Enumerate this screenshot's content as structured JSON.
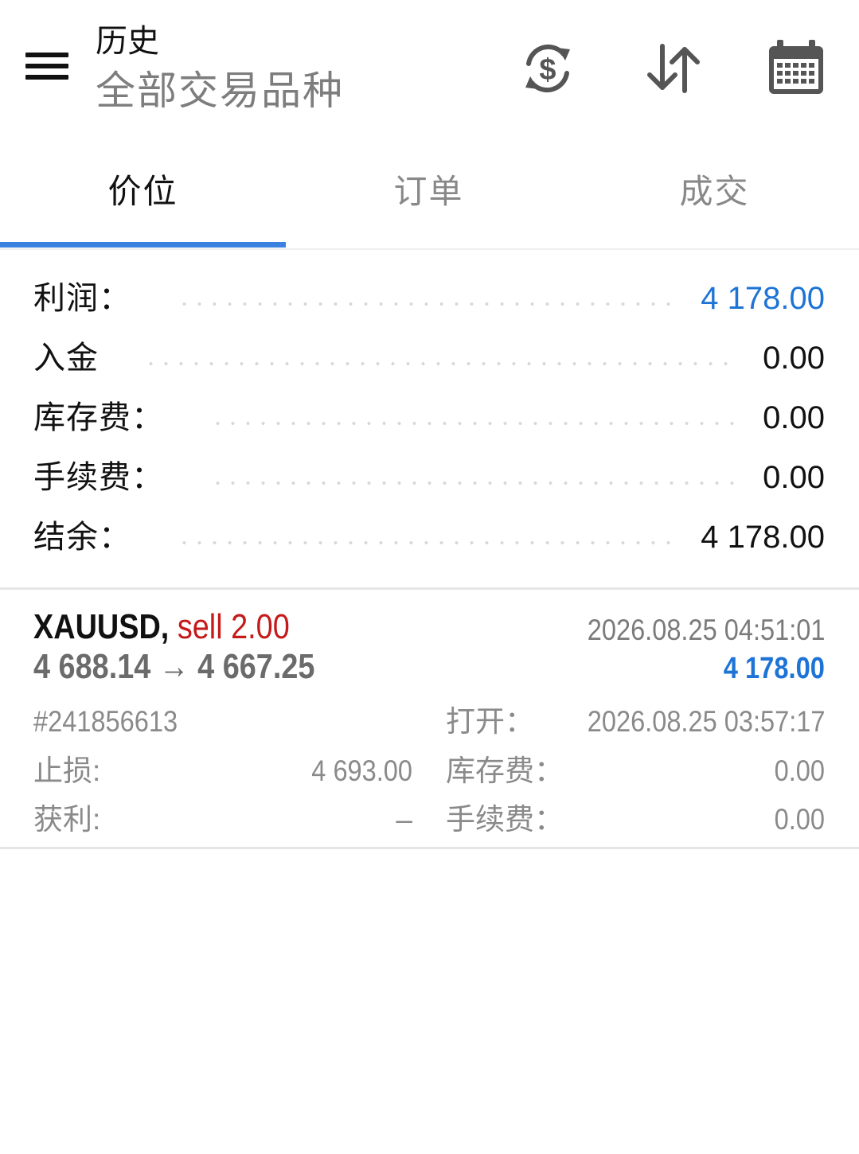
{
  "header": {
    "title": "历史",
    "subtitle": "全部交易品种",
    "icons": [
      "menu-icon",
      "currency-exchange-icon",
      "sort-icon",
      "calendar-icon"
    ]
  },
  "tabs": [
    {
      "label": "价位",
      "active": true
    },
    {
      "label": "订单",
      "active": false
    },
    {
      "label": "成交",
      "active": false
    }
  ],
  "summary": {
    "profit": {
      "label": "利润：",
      "value": "4 178.00"
    },
    "deposit": {
      "label": "入金",
      "value": "0.00"
    },
    "swap": {
      "label": "库存费：",
      "value": "0.00"
    },
    "commission": {
      "label": "手续费：",
      "value": "0.00"
    },
    "balance": {
      "label": "结余：",
      "value": "4 178.00"
    }
  },
  "deal": {
    "symbol": "XAUUSD,",
    "type_volume": "sell 2.00",
    "prices": "4 688.14 → 4 667.25",
    "close_time": "2026.08.25 04:51:01",
    "profit": "4 178.00",
    "ticket": "#241856613",
    "open_label": "打开：",
    "open_time": "2026.08.25 03:57:17",
    "sl_label": "止损:",
    "sl_value": "4 693.00",
    "swap_label": "库存费：",
    "swap_value": "0.00",
    "tp_label": "获利:",
    "tp_value": "–",
    "commission_label": "手续费：",
    "commission_value": "0.00"
  },
  "colors": {
    "accent": "#3b82e0",
    "profit_blue": "#1e74d6",
    "sell_red": "#c41a1a",
    "muted_gray": "#8a8a8a"
  }
}
